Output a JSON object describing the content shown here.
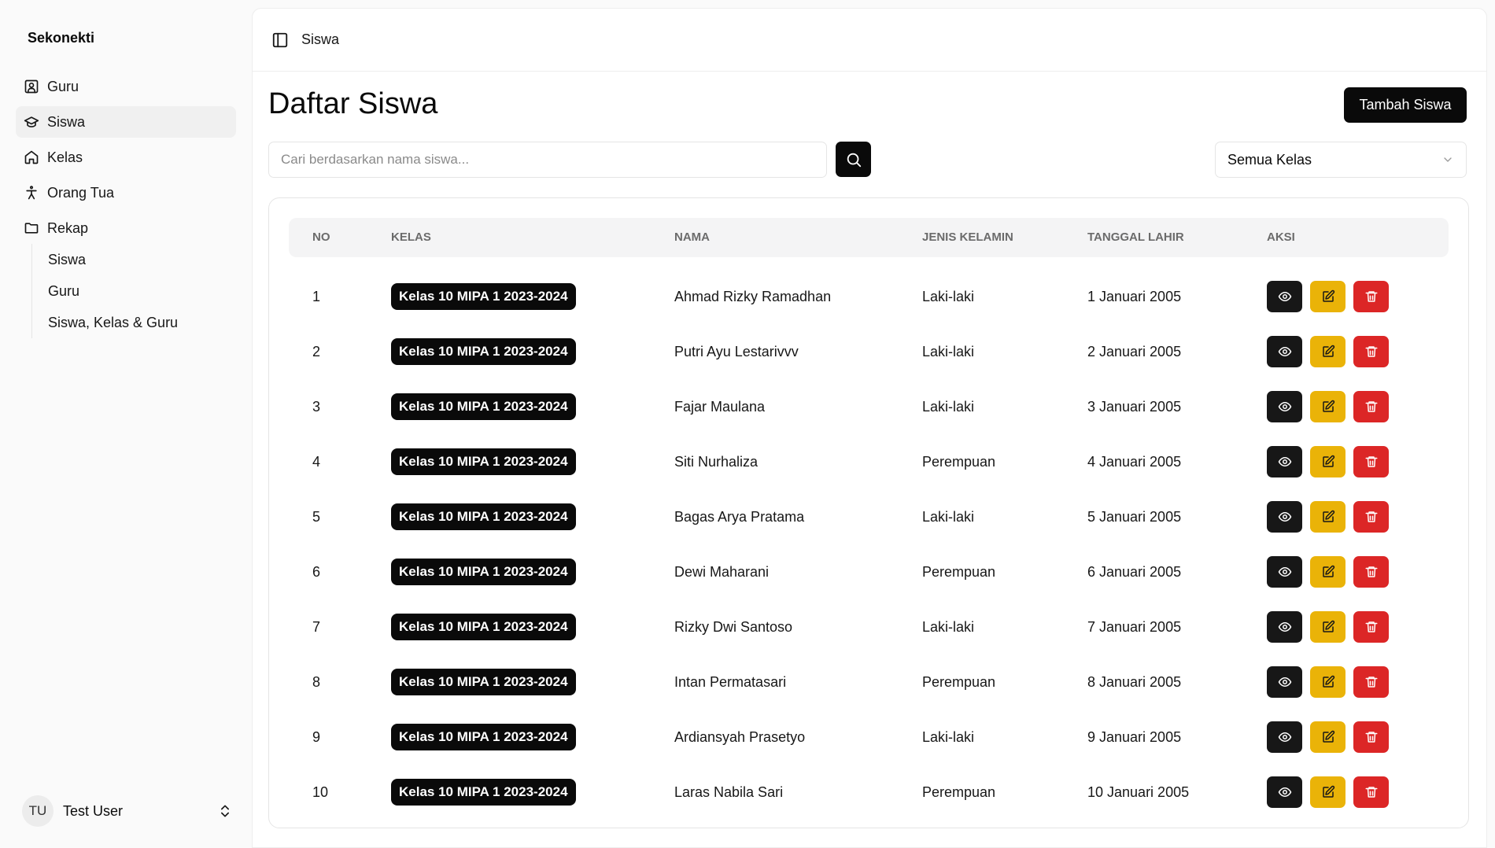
{
  "app": {
    "name": "Sekonekti"
  },
  "sidebar": {
    "items": [
      {
        "label": "Guru",
        "icon": "contact-icon"
      },
      {
        "label": "Siswa",
        "icon": "graduation-cap-icon",
        "active": true
      },
      {
        "label": "Kelas",
        "icon": "home-icon"
      },
      {
        "label": "Orang Tua",
        "icon": "person-icon"
      },
      {
        "label": "Rekap",
        "icon": "folder-icon"
      }
    ],
    "rekap_sub": [
      "Siswa",
      "Guru",
      "Siswa, Kelas & Guru"
    ],
    "user": {
      "initials": "TU",
      "name": "Test User"
    }
  },
  "header": {
    "breadcrumb": "Siswa"
  },
  "page": {
    "title": "Daftar Siswa",
    "add_label": "Tambah Siswa",
    "search_placeholder": "Cari berdasarkan nama siswa...",
    "filter_value": "Semua Kelas"
  },
  "table": {
    "headers": {
      "no": "NO",
      "kelas": "KELAS",
      "nama": "NAMA",
      "jk": "JENIS KELAMIN",
      "tgl": "TANGGAL LAHIR",
      "aksi": "AKSI"
    },
    "rows": [
      {
        "no": "1",
        "kelas": "Kelas 10 MIPA 1 2023-2024",
        "nama": "Ahmad Rizky Ramadhan",
        "jk": "Laki-laki",
        "tgl": "1 Januari 2005"
      },
      {
        "no": "2",
        "kelas": "Kelas 10 MIPA 1 2023-2024",
        "nama": "Putri Ayu Lestarivvv",
        "jk": "Laki-laki",
        "tgl": "2 Januari 2005"
      },
      {
        "no": "3",
        "kelas": "Kelas 10 MIPA 1 2023-2024",
        "nama": "Fajar Maulana",
        "jk": "Laki-laki",
        "tgl": "3 Januari 2005"
      },
      {
        "no": "4",
        "kelas": "Kelas 10 MIPA 1 2023-2024",
        "nama": "Siti Nurhaliza",
        "jk": "Perempuan",
        "tgl": "4 Januari 2005"
      },
      {
        "no": "5",
        "kelas": "Kelas 10 MIPA 1 2023-2024",
        "nama": "Bagas Arya Pratama",
        "jk": "Laki-laki",
        "tgl": "5 Januari 2005"
      },
      {
        "no": "6",
        "kelas": "Kelas 10 MIPA 1 2023-2024",
        "nama": "Dewi Maharani",
        "jk": "Perempuan",
        "tgl": "6 Januari 2005"
      },
      {
        "no": "7",
        "kelas": "Kelas 10 MIPA 1 2023-2024",
        "nama": "Rizky Dwi Santoso",
        "jk": "Laki-laki",
        "tgl": "7 Januari 2005"
      },
      {
        "no": "8",
        "kelas": "Kelas 10 MIPA 1 2023-2024",
        "nama": "Intan Permatasari",
        "jk": "Perempuan",
        "tgl": "8 Januari 2005"
      },
      {
        "no": "9",
        "kelas": "Kelas 10 MIPA 1 2023-2024",
        "nama": "Ardiansyah Prasetyo",
        "jk": "Laki-laki",
        "tgl": "9 Januari 2005"
      },
      {
        "no": "10",
        "kelas": "Kelas 10 MIPA 1 2023-2024",
        "nama": "Laras Nabila Sari",
        "jk": "Perempuan",
        "tgl": "10 Januari 2005"
      }
    ]
  },
  "colors": {
    "view": "#171717",
    "edit": "#eab308",
    "delete": "#dc2626",
    "primary": "#0a0a0a"
  }
}
